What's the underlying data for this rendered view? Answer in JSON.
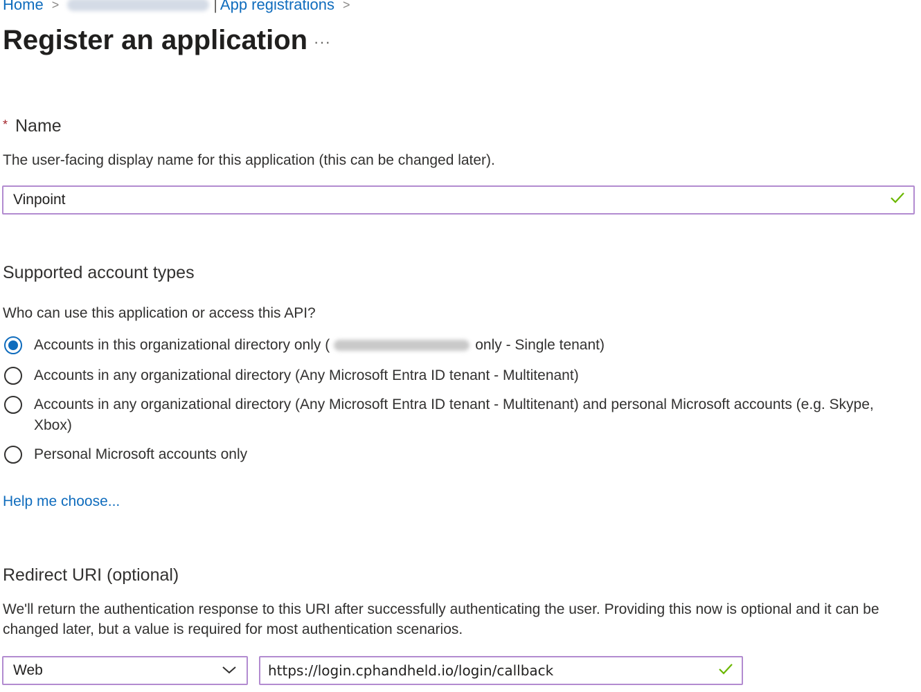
{
  "breadcrumb": {
    "home": "Home",
    "app_registrations": "App registrations"
  },
  "page": {
    "title": "Register an application",
    "more": "···"
  },
  "name_section": {
    "required_mark": "*",
    "label": "Name",
    "description": "The user-facing display name for this application (this can be changed later).",
    "value": "Vinpoint"
  },
  "account_types": {
    "heading": "Supported account types",
    "question": "Who can use this application or access this API?",
    "options": [
      {
        "label_before": "Accounts in this organizational directory only (",
        "label_after": "only - Single tenant)",
        "selected": true
      },
      {
        "label": "Accounts in any organizational directory (Any Microsoft Entra ID tenant - Multitenant)",
        "selected": false
      },
      {
        "label_line1": "Accounts in any organizational directory (Any Microsoft Entra ID tenant - Multitenant) and personal Microsoft accounts (e.g. Skype,",
        "label_line2": "Xbox)",
        "selected": false
      },
      {
        "label": "Personal Microsoft accounts only",
        "selected": false
      }
    ],
    "help_link": "Help me choose..."
  },
  "redirect": {
    "heading": "Redirect URI (optional)",
    "description_line1": "We'll return the authentication response to this URI after successfully authenticating the user. Providing this now is optional and it can be",
    "description_line2": "changed later, but a value is required for most authentication scenarios.",
    "platform": "Web",
    "uri": "https://login.cphandheld.io/login/callback"
  },
  "colors": {
    "accent": "#0f6cbd",
    "input_border": "#b28bd0",
    "valid_check": "#6bb700",
    "required": "#a4262c"
  }
}
